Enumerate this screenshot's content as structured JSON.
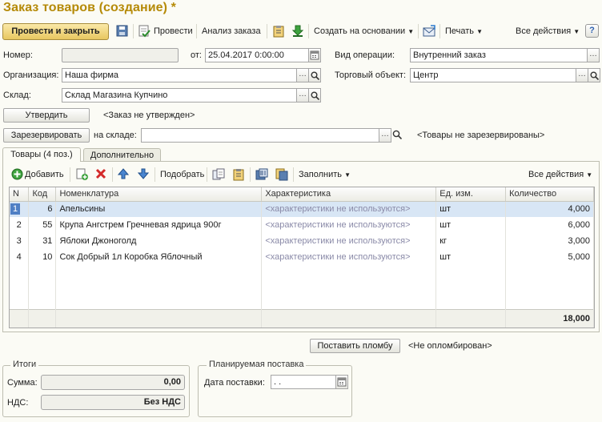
{
  "window": {
    "title": "Заказ товаров (создание) *"
  },
  "toolbar": {
    "post_close": "Провести и закрыть",
    "post": "Провести",
    "analysis": "Анализ заказа",
    "create_based": "Создать на основании",
    "print": "Печать",
    "all_actions": "Все действия",
    "help": "?"
  },
  "form": {
    "number_label": "Номер:",
    "number_value": "",
    "from_label": "от:",
    "date_value": "25.04.2017  0:00:00",
    "operation_label": "Вид операции:",
    "operation_value": "Внутренний заказ",
    "org_label": "Организация:",
    "org_value": "Наша фирма",
    "trade_object_label": "Торговый объект:",
    "trade_object_value": "Центр",
    "warehouse_label": "Склад:",
    "warehouse_value": "Склад Магазина Купчино",
    "approve_button": "Утвердить",
    "approve_status": "<Заказ не утвержден>",
    "reserve_button": "Зарезервировать",
    "on_warehouse_label": "на складе:",
    "reserve_warehouse_value": "",
    "reserve_status": "<Товары не зарезервированы>"
  },
  "tabs": [
    {
      "label": "Товары (4 поз.)"
    },
    {
      "label": "Дополнительно"
    }
  ],
  "table_toolbar": {
    "add": "Добавить",
    "select": "Подобрать",
    "fill": "Заполнить",
    "all_actions": "Все действия"
  },
  "table": {
    "columns": [
      "N",
      "Код",
      "Номенклатура",
      "Характеристика",
      "Ед. изм.",
      "Количество"
    ],
    "rows": [
      {
        "n": "1",
        "code": "6",
        "name": "Апельсины",
        "char": "<характеристики не используются>",
        "unit": "шт",
        "qty": "4,000"
      },
      {
        "n": "2",
        "code": "55",
        "name": "Крупа Ангстрем Гречневая ядрица 900г",
        "char": "<характеристики не используются>",
        "unit": "шт",
        "qty": "6,000"
      },
      {
        "n": "3",
        "code": "31",
        "name": "Яблоки Джоноголд",
        "char": "<характеристики не используются>",
        "unit": "кг",
        "qty": "3,000"
      },
      {
        "n": "4",
        "code": "10",
        "name": "Сок Добрый 1л Коробка Яблочный",
        "char": "<характеристики не используются>",
        "unit": "шт",
        "qty": "5,000"
      }
    ],
    "total_qty": "18,000"
  },
  "seal": {
    "button": "Поставить пломбу",
    "status": "<Не опломбирован>"
  },
  "totals": {
    "legend": "Итоги",
    "sum_label": "Сумма:",
    "sum_value": "0,00",
    "vat_label": "НДС:",
    "vat_value": "Без НДС"
  },
  "delivery": {
    "legend": "Планируемая поставка",
    "date_label": "Дата поставки:",
    "date_value": " .  ."
  },
  "colors": {
    "title": "#b58a07",
    "primary_button": "#e8c760",
    "selected_row": "#d8e6f5"
  }
}
